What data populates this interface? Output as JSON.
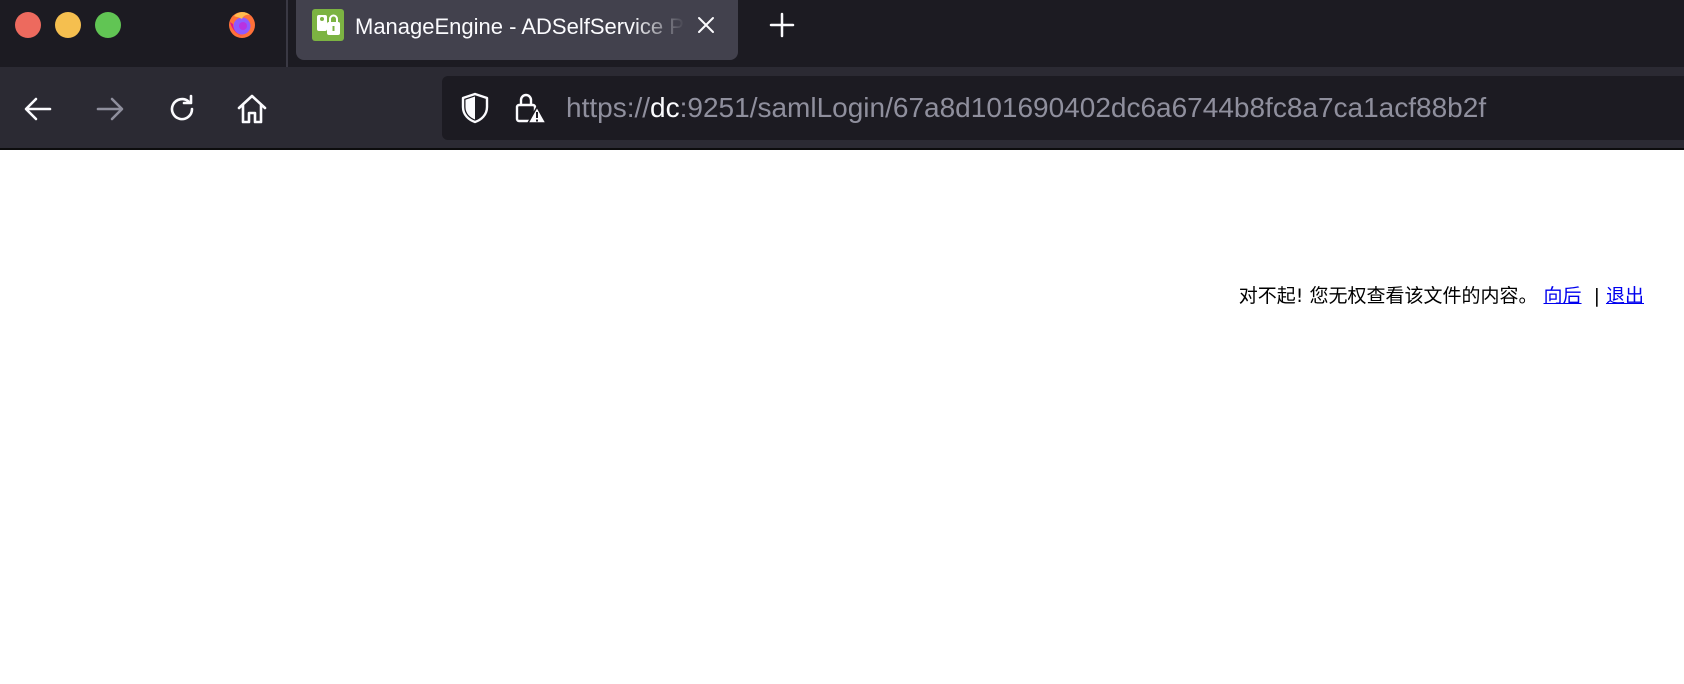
{
  "window": {
    "traffic_lights": [
      "close",
      "minimize",
      "maximize"
    ]
  },
  "tab": {
    "title": "ManageEngine - ADSelfService Plus",
    "favicon": "manageengine-adselfservice-icon"
  },
  "toolbar": {
    "icons": [
      "back-arrow-icon",
      "forward-arrow-icon",
      "reload-icon",
      "home-icon"
    ]
  },
  "urlbar": {
    "scheme": "https://",
    "host": "dc",
    "rest": ":9251/samlLogin/67a8d101690402dc6a6744b8fc8a7ca1acf88b2f",
    "icons": [
      "tracking-protection-shield-icon",
      "insecure-lock-warning-icon"
    ]
  },
  "page": {
    "message": "对不起! 您无权查看该文件的内容。",
    "back_link": "向后",
    "separator": "|",
    "logout_link": "退出"
  },
  "colors": {
    "tabbar_bg": "#1c1b22",
    "navbar_bg": "#2b2a33",
    "active_tab_bg": "#42414d",
    "link": "#0000ee"
  }
}
